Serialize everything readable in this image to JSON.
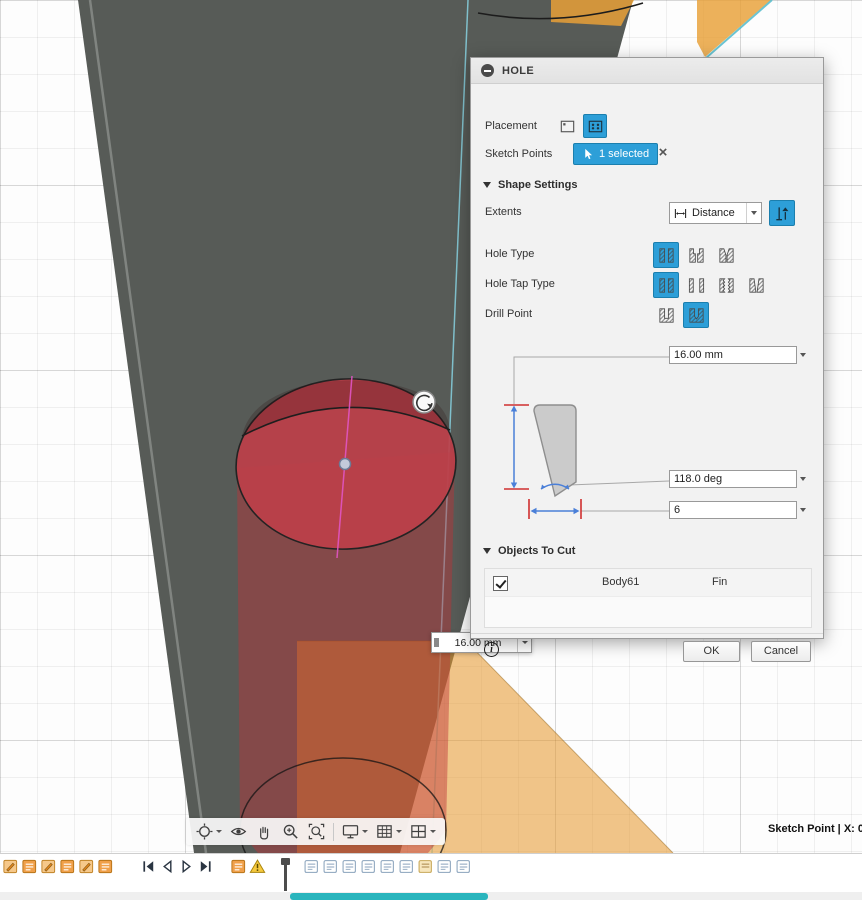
{
  "colors": {
    "accent_blue": "#2d9fd8",
    "hole_preview_red": "#bc4049",
    "body_gray": "#575b57",
    "body_orange": "#e8a33d",
    "timeline_scrollbar_teal": "#2ab5bd",
    "dimension_blue": "#4a7fd8",
    "dimension_red": "#d03030"
  },
  "dialog": {
    "title": "HOLE",
    "placement": {
      "label": "Placement",
      "options": [
        {
          "name": "single",
          "selected": false
        },
        {
          "name": "multiple",
          "selected": true
        }
      ]
    },
    "sketch_points": {
      "label": "Sketch Points",
      "value": "1 selected"
    },
    "shape_settings_label": "Shape Settings",
    "extents": {
      "label": "Extents",
      "value": "Distance",
      "flip_selected": true
    },
    "hole_type": {
      "label": "Hole Type",
      "options": [
        {
          "name": "simple",
          "selected": true
        },
        {
          "name": "counterbore",
          "selected": false
        },
        {
          "name": "countersink",
          "selected": false
        }
      ]
    },
    "hole_tap_type": {
      "label": "Hole Tap Type",
      "options": [
        {
          "name": "simple",
          "selected": true
        },
        {
          "name": "clearance",
          "selected": false
        },
        {
          "name": "tapped",
          "selected": false
        },
        {
          "name": "taper-tapped",
          "selected": false
        }
      ]
    },
    "drill_point": {
      "label": "Drill Point",
      "options": [
        {
          "name": "flat",
          "selected": false
        },
        {
          "name": "angle",
          "selected": true
        }
      ]
    },
    "inputs": {
      "depth": "16.00 mm",
      "angle": "118.0 deg",
      "diameter": "6"
    },
    "objects_to_cut": {
      "label": "Objects To Cut",
      "rows": [
        {
          "checked": true,
          "body": "Body61",
          "component": "Fin"
        }
      ]
    },
    "footer": {
      "ok": "OK",
      "cancel": "Cancel"
    }
  },
  "viewport": {
    "floating_input": {
      "value": "16.00 mm"
    },
    "status_text": "Sketch Point | X: 0"
  },
  "navbar": {
    "items": [
      {
        "name": "orbit",
        "dropdown": true
      },
      {
        "name": "look-at"
      },
      {
        "name": "pan"
      },
      {
        "name": "zoom"
      },
      {
        "name": "fit"
      },
      {
        "separator": true
      },
      {
        "name": "display-settings",
        "dropdown": true
      },
      {
        "name": "grid-display",
        "dropdown": true
      },
      {
        "name": "viewports",
        "dropdown": true
      }
    ]
  },
  "timeline": {
    "items": [
      {
        "icon": "sketch"
      },
      {
        "icon": "feature"
      },
      {
        "icon": "sketch"
      },
      {
        "icon": "feature"
      },
      {
        "icon": "sketch"
      },
      {
        "icon": "feature"
      },
      {
        "spacer": 22
      },
      {
        "icon": "skip-start"
      },
      {
        "icon": "step-back"
      },
      {
        "icon": "step-forward"
      },
      {
        "icon": "skip-end"
      },
      {
        "spacer": 12
      },
      {
        "icon": "feature"
      },
      {
        "icon": "warning"
      },
      {
        "spacer": 10
      },
      {
        "icon": "marker"
      },
      {
        "spacer": 8
      },
      {
        "icon": "feature-outline"
      },
      {
        "icon": "feature-outline"
      },
      {
        "icon": "feature-outline"
      },
      {
        "icon": "feature-outline"
      },
      {
        "icon": "feature-outline"
      },
      {
        "icon": "feature-outline"
      },
      {
        "icon": "feature-gold"
      },
      {
        "icon": "feature-outline"
      },
      {
        "icon": "feature-outline"
      }
    ]
  }
}
